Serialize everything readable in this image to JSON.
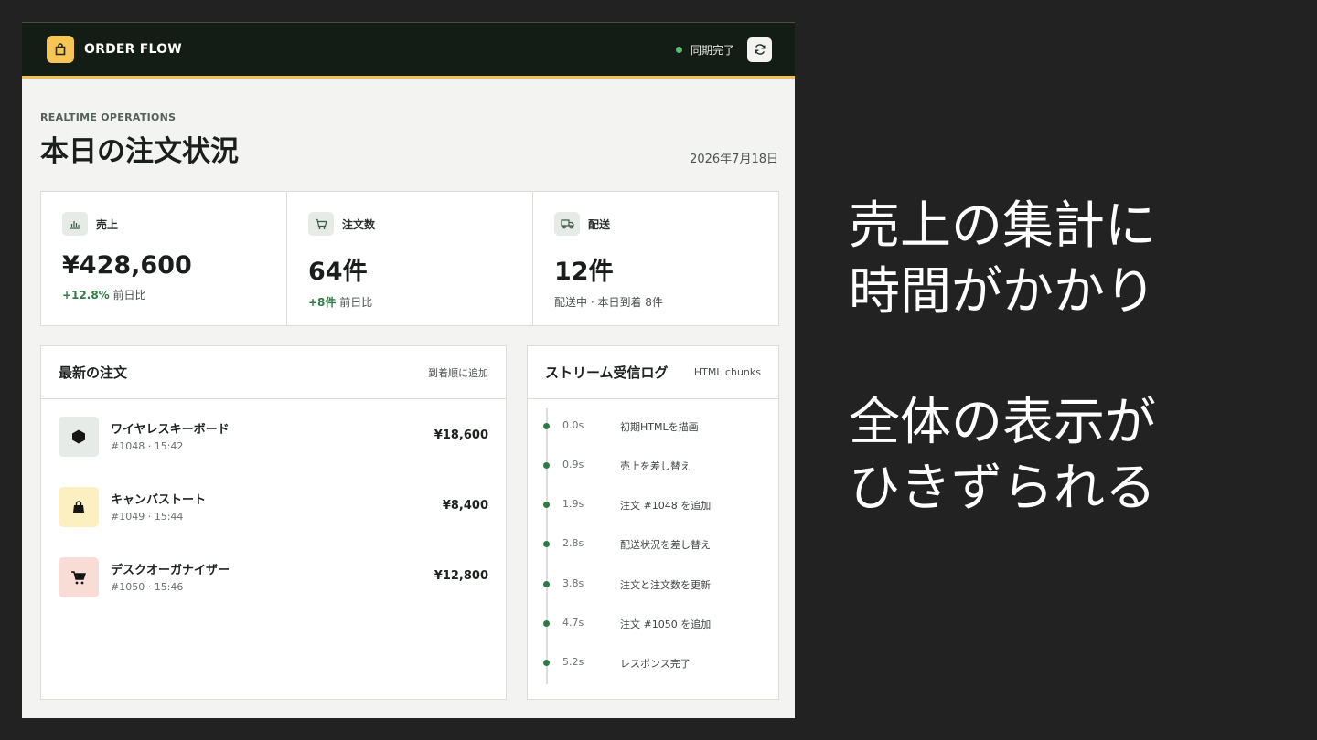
{
  "header": {
    "brand": "ORDER FLOW",
    "sync_status": "同期完了"
  },
  "page": {
    "eyebrow": "REALTIME OPERATIONS",
    "title": "本日の注文状況",
    "date": "2026年7月18日"
  },
  "stats": [
    {
      "icon": "bar-chart-icon",
      "label": "売上",
      "value": "¥428,600",
      "delta": "+12.8%",
      "sub": "前日比"
    },
    {
      "icon": "cart-icon",
      "label": "注文数",
      "value": "64件",
      "delta": "+8件",
      "sub": "前日比"
    },
    {
      "icon": "truck-icon",
      "label": "配送",
      "value": "12件",
      "sub": "配送中 · 本日到着 8件"
    }
  ],
  "orders": {
    "title": "最新の注文",
    "note": "到着順に追加",
    "items": [
      {
        "name": "ワイヤレスキーボード",
        "meta": "#1048 · 15:42",
        "price": "¥18,600",
        "icon": "hexagon-icon",
        "color": "#e6ebe7"
      },
      {
        "name": "キャンバストート",
        "meta": "#1049 · 15:44",
        "price": "¥8,400",
        "icon": "bag-icon",
        "color": "#fcefc0"
      },
      {
        "name": "デスクオーガナイザー",
        "meta": "#1050 · 15:46",
        "price": "¥12,800",
        "icon": "cart-icon",
        "color": "#f7ddd6"
      }
    ]
  },
  "stream": {
    "title": "ストリーム受信ログ",
    "note": "HTML chunks",
    "logs": [
      {
        "time": "0.0s",
        "text": "初期HTMLを描画"
      },
      {
        "time": "0.9s",
        "text": "売上を差し替え"
      },
      {
        "time": "1.9s",
        "text": "注文 #1048 を追加"
      },
      {
        "time": "2.8s",
        "text": "配送状況を差し替え"
      },
      {
        "time": "3.8s",
        "text": "注文と注文数を更新"
      },
      {
        "time": "4.7s",
        "text": "注文 #1050 を追加"
      },
      {
        "time": "5.2s",
        "text": "レスポンス完了"
      }
    ]
  },
  "caption": {
    "block1": [
      "売上の集計に",
      "時間がかかり"
    ],
    "block2": [
      "全体の表示が",
      "ひきずられる"
    ]
  }
}
